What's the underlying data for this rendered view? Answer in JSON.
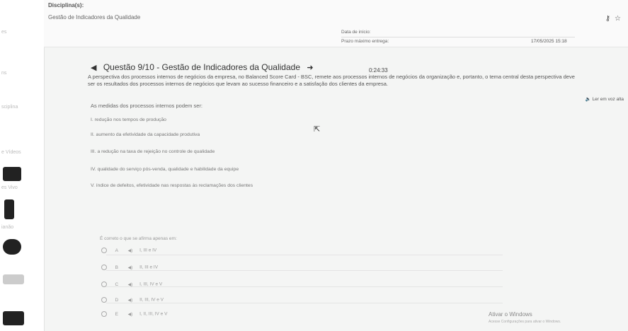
{
  "sidebar": {
    "labels": [
      "es",
      "ns",
      "sciplina",
      "e Vídeos",
      "es Vivo",
      "ianão"
    ]
  },
  "header": {
    "disciplina_label": "Disciplina(s):",
    "disciplina_name": "Gestão de Indicadores da Qualidade",
    "icons": [
      "key-icon",
      "star-icon"
    ],
    "inicio_label": "Data de início:",
    "prazo_label": "Prazo máximo entrega:",
    "prazo_value": "17/05/2025 15:18"
  },
  "question": {
    "title": "Questão 9/10 - Gestão de Indicadores da Qualidade",
    "timer": "0:24:33",
    "text": "A perspectiva dos processos internos de negócios da empresa, no Balanced Score Card - BSC, remete aos processos internos de negócios da organização e, portanto, o tema central desta perspectiva deve ser os resultados dos processos internos de negócios que levam ao sucesso financeiro e a satisfação dos clientes da empresa.",
    "read_aloud": "Ler em voz alta",
    "prompt": "As medidas dos processos internos podem ser:",
    "items": [
      "I. redução nos tempos de produção",
      "II. aumento da efetividade da capacidade produtiva",
      "III. a redução na taxa de rejeição no controle de qualidade",
      "IV. qualidade do serviço pós-venda, qualidade e habilidade da equipe",
      "V. índice de defeitos, efetividade nas respostas às reclamações dos clientes"
    ],
    "ask": "É correto o que se afirma apenas em:",
    "options": [
      {
        "letter": "A",
        "text": "I, III e IV"
      },
      {
        "letter": "B",
        "text": "II, III e IV"
      },
      {
        "letter": "C",
        "text": "I, III, IV e V"
      },
      {
        "letter": "D",
        "text": "II, III, IV e V"
      },
      {
        "letter": "E",
        "text": "I, II, III, IV e V"
      }
    ]
  },
  "windows": {
    "activate": "Ativar o Windows",
    "activate_sub": "Acesse Configurações para ativar o Windows."
  }
}
